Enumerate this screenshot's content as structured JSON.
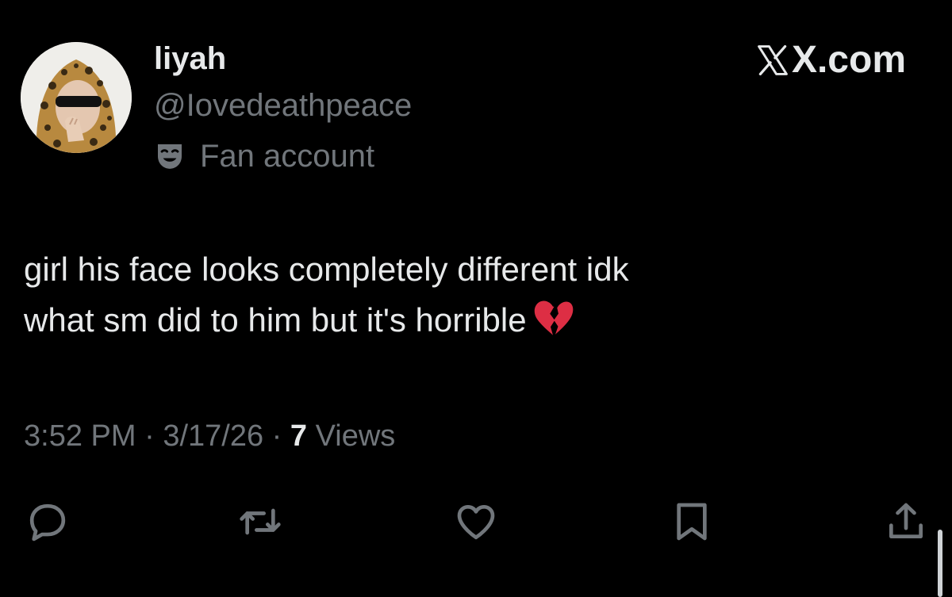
{
  "tweet": {
    "author": {
      "display_name": "liyah",
      "handle": "@Iovedeathpeace",
      "label": "Fan account",
      "avatar_icon": "avatar-photo",
      "label_icon": "theater-mask-icon"
    },
    "watermark": {
      "text": "X.com",
      "icon": "x-logo-icon"
    },
    "text_lines": [
      "girl his face looks completely different idk",
      "what sm did to him but it's horrible"
    ],
    "emoji": "broken-heart-emoji",
    "meta": {
      "time": "3:52 PM",
      "separator": " · ",
      "date": "3/17/26",
      "views_count": "7",
      "views_label": " Views"
    },
    "actions": [
      {
        "name": "reply",
        "icon": "reply-icon"
      },
      {
        "name": "repost",
        "icon": "repost-icon"
      },
      {
        "name": "like",
        "icon": "heart-icon"
      },
      {
        "name": "bookmark",
        "icon": "bookmark-icon"
      },
      {
        "name": "share",
        "icon": "share-icon"
      }
    ],
    "colors": {
      "background": "#000000",
      "primary_text": "#e7e9ea",
      "secondary_text": "#71767b",
      "emoji_red": "#dd2e44"
    }
  }
}
